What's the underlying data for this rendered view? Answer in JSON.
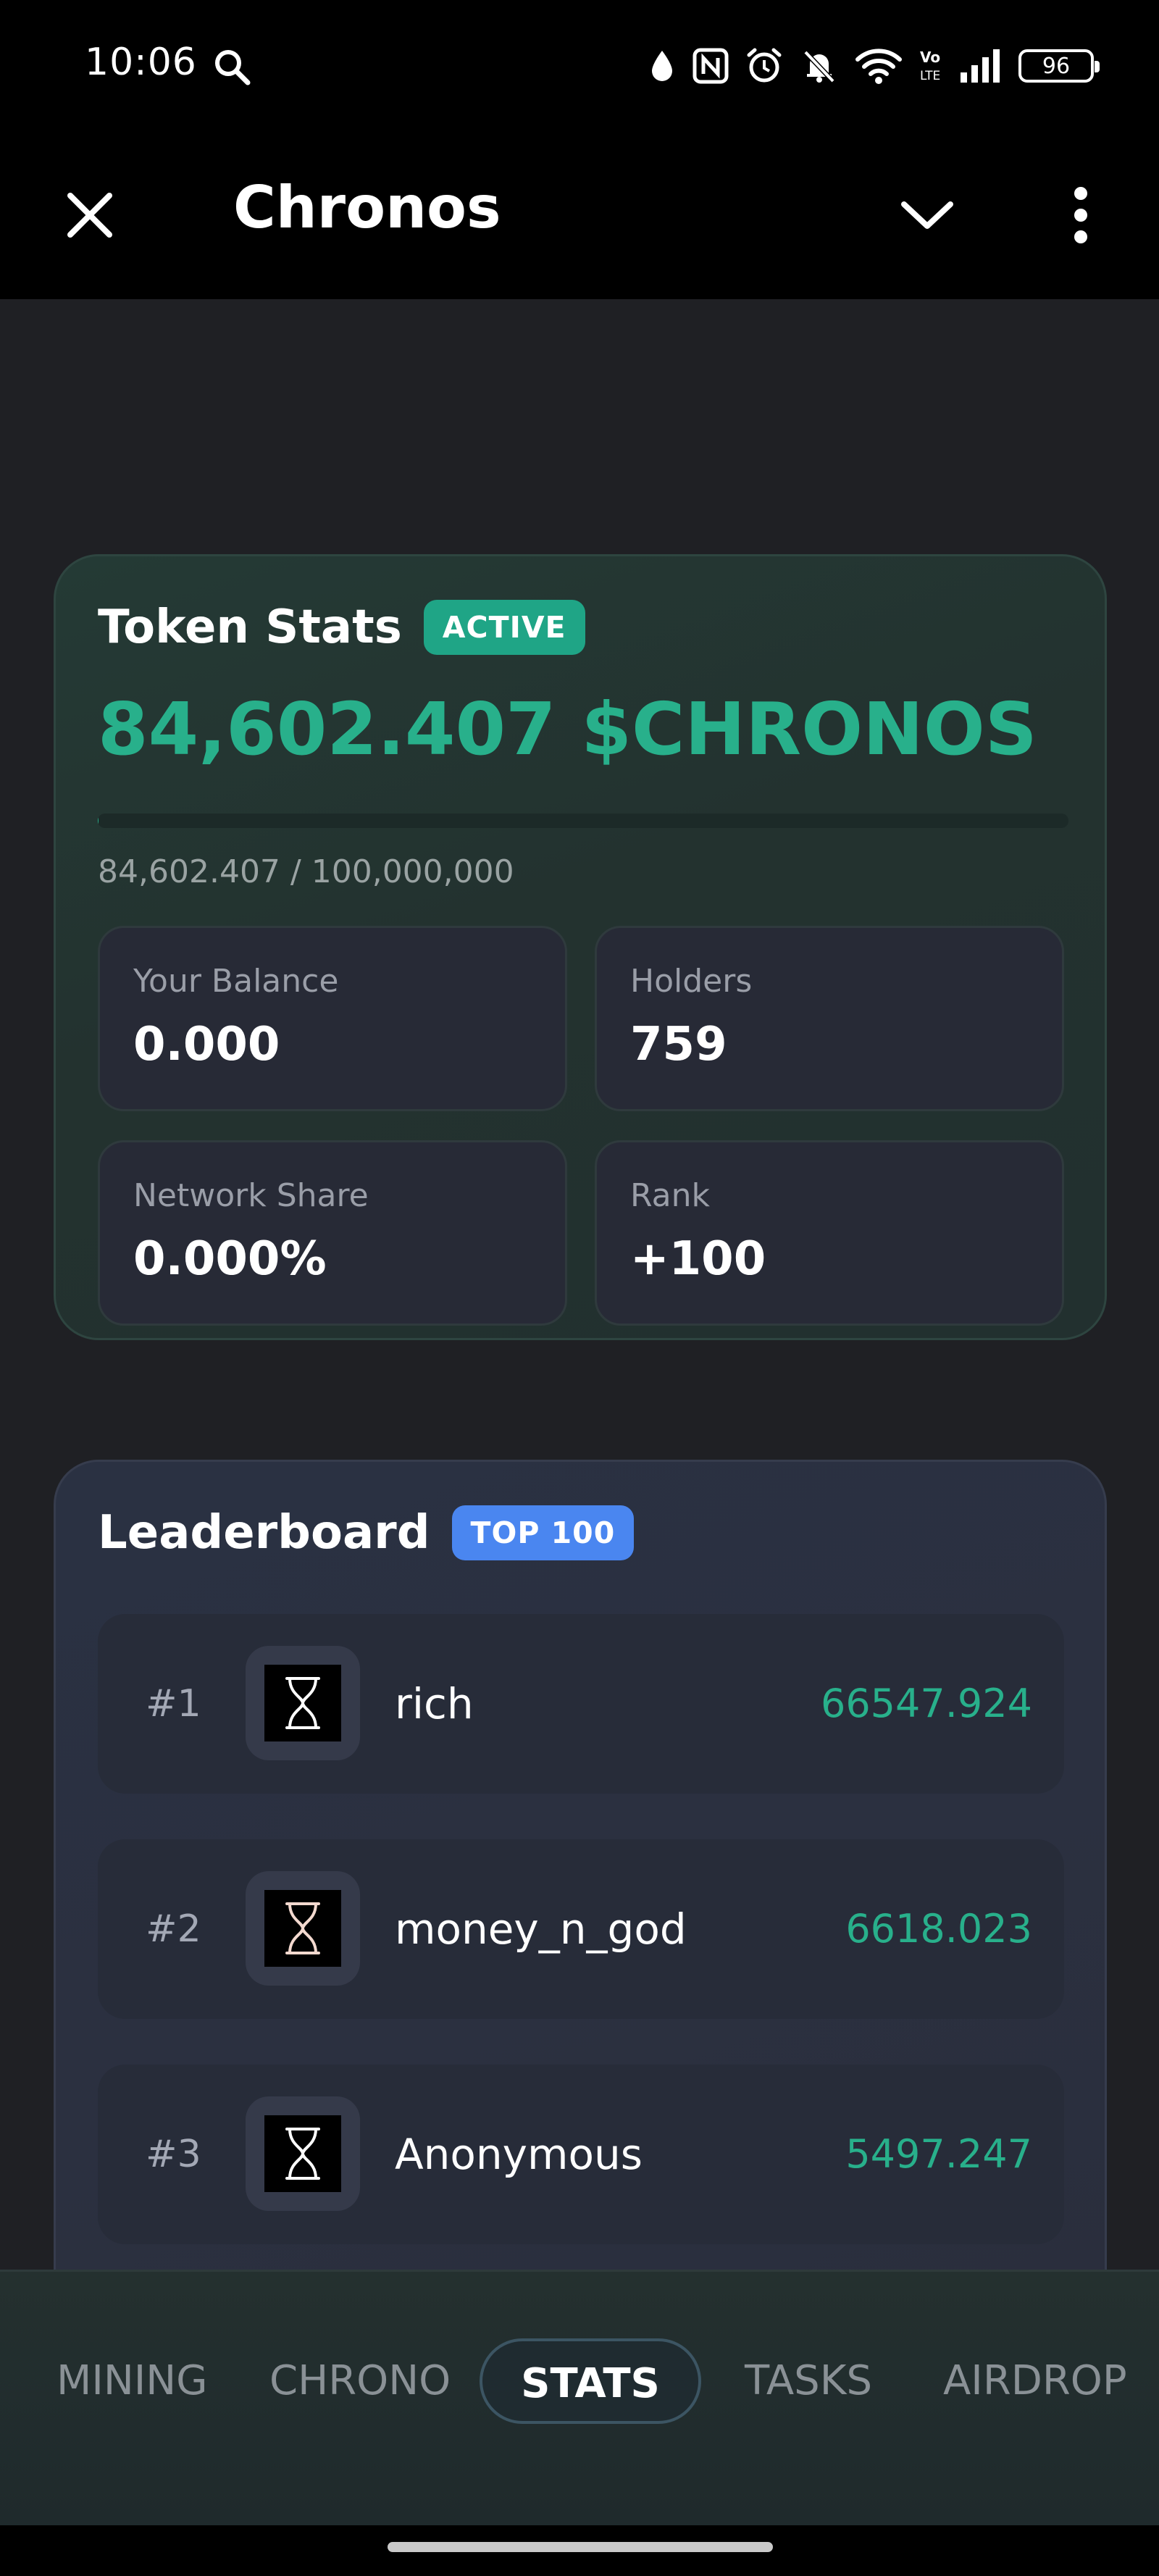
{
  "status_bar": {
    "time": "10:06",
    "battery": "96",
    "icons": [
      "search-icon",
      "data-saver-icon",
      "nfc-icon",
      "alarm-icon",
      "mute-icon",
      "wifi-icon",
      "volte-icon",
      "signal-icon",
      "battery-icon"
    ]
  },
  "app_bar": {
    "title": "Chronos",
    "icons": [
      "close-icon",
      "chevron-down-icon",
      "more-vertical-icon"
    ]
  },
  "token_stats": {
    "title": "Token Stats",
    "badge": "ACTIVE",
    "amount": "84,602.407 $CHRONOS",
    "supply": "84,602.407 / 100,000,000",
    "progress_fraction": 0.000846,
    "boxes": [
      {
        "label": "Your Balance",
        "value": "0.000"
      },
      {
        "label": "Holders",
        "value": "759"
      },
      {
        "label": "Network Share",
        "value": "0.000%"
      },
      {
        "label": "Rank",
        "value": "+100"
      }
    ],
    "colors": {
      "accent": "#28b08b",
      "badge": "#1fa586"
    }
  },
  "leaderboard": {
    "title": "Leaderboard",
    "badge": "TOP 100",
    "avatar_icon": "hourglass-icon",
    "rows": [
      {
        "rank": "#1",
        "name": "rich",
        "score": "66547.924"
      },
      {
        "rank": "#2",
        "name": "money_n_god",
        "score": "6618.023"
      },
      {
        "rank": "#3",
        "name": "Anonymous",
        "score": "5497.247"
      },
      {
        "rank": "",
        "name": "",
        "score": ""
      }
    ],
    "colors": {
      "badge": "#4a86f0"
    }
  },
  "bottom_nav": {
    "items": [
      "MINING",
      "CHRONO",
      "STATS",
      "TASKS",
      "AIRDROP"
    ],
    "active": "STATS"
  }
}
